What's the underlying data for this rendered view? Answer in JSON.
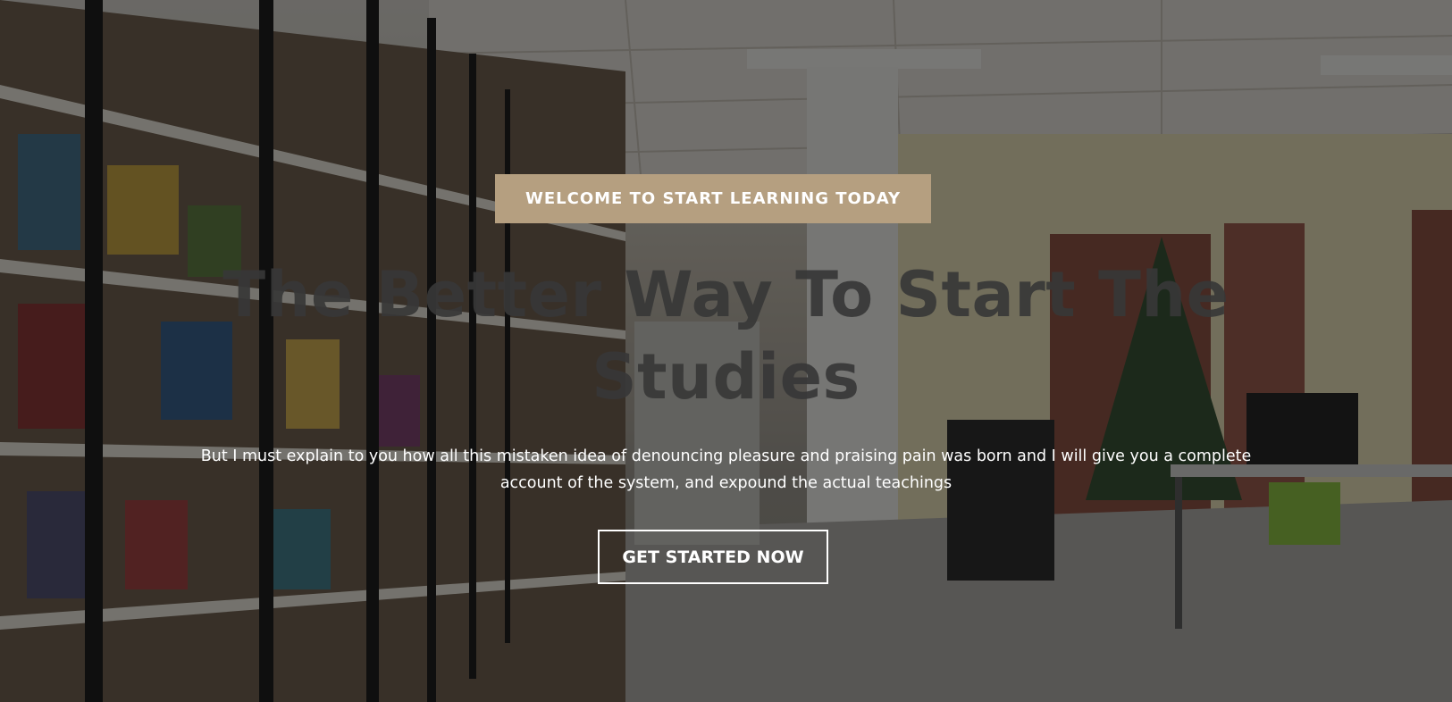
{
  "hero": {
    "badge_text": "WELCOME TO START LEARNING TODAY",
    "headline": "The Better Way To Start The Studies",
    "description": "But I must explain to you how all this mistaken idea of denouncing pleasure and praising pain was born and I will give you a complete account of the system, and expound the actual teachings",
    "cta_label": "GET STARTED NOW",
    "background_image": "library-interior",
    "colors": {
      "badge_background": "#b59f80",
      "headline_color": "#373737",
      "text_color": "#ffffff",
      "overlay": "#0f0f0f"
    }
  }
}
